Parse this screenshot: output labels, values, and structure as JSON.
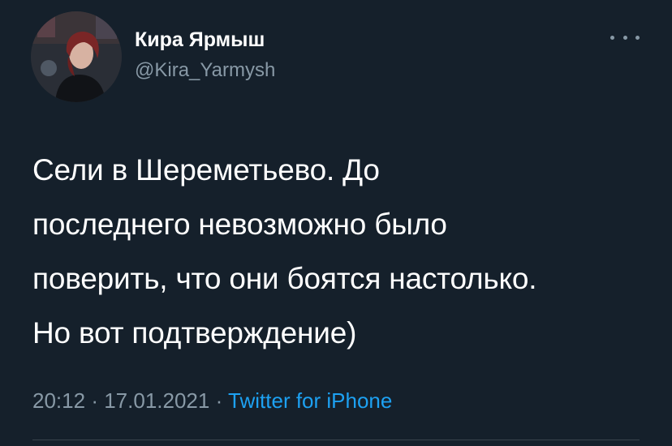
{
  "tweet": {
    "author": {
      "display_name": "Кира Ярмыш",
      "handle": "@Kira_Yarmysh"
    },
    "more_icon": "more-horizontal-icon",
    "text_lines": [
      "Сели в Шереметьево. До",
      "последнего невозможно было",
      "поверить, что они боятся настолько.",
      "Но вот подтверждение)"
    ],
    "meta": {
      "time": "20:12",
      "separator": "·",
      "date": "17.01.2021",
      "source": "Twitter for iPhone"
    }
  },
  "colors": {
    "background": "#15202b",
    "secondary_text": "#8899a6",
    "link": "#1da1f2",
    "divider": "#38444d"
  }
}
